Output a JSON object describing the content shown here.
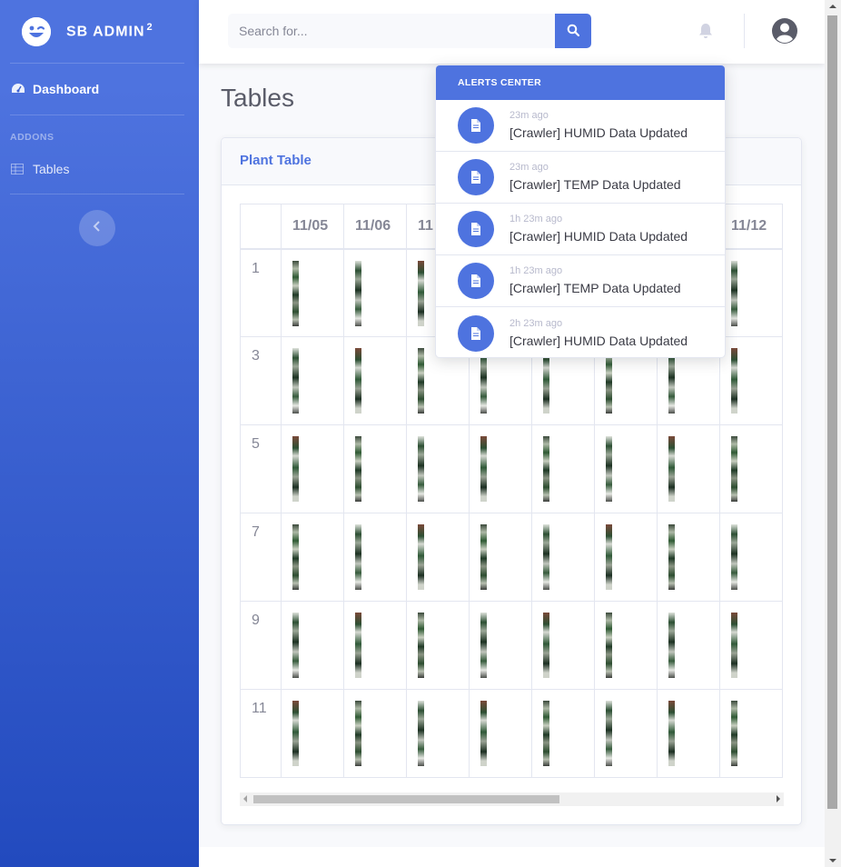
{
  "sidebar": {
    "brand": "SB ADMIN",
    "brand_sup": "2",
    "dashboard_label": "Dashboard",
    "addons_heading": "ADDONS",
    "tables_label": "Tables"
  },
  "topbar": {
    "search_placeholder": "Search for..."
  },
  "page": {
    "title": "Tables"
  },
  "card": {
    "title": "Plant Table"
  },
  "table": {
    "headers": [
      "",
      "11/05",
      "11/06",
      "11",
      "",
      "",
      "",
      "",
      "11/12"
    ],
    "row_labels": [
      "1",
      "3",
      "5",
      "7",
      "9",
      "11"
    ]
  },
  "alerts": {
    "header": "ALERTS CENTER",
    "items": [
      {
        "time": "23m ago",
        "text": "[Crawler] HUMID Data Updated"
      },
      {
        "time": "23m ago",
        "text": "[Crawler] TEMP Data Updated"
      },
      {
        "time": "1h 23m ago",
        "text": "[Crawler] HUMID Data Updated"
      },
      {
        "time": "1h 23m ago",
        "text": "[Crawler] TEMP Data Updated"
      },
      {
        "time": "2h 23m ago",
        "text": "[Crawler] HUMID Data Updated"
      }
    ]
  },
  "colors": {
    "primary": "#4e73df",
    "sidebar_gradient_end": "#224abe"
  },
  "icons": {
    "brand": "laugh-wink-icon",
    "dashboard": "tachometer-icon",
    "tables": "table-icon",
    "toggle": "chevron-left-icon",
    "search": "search-icon",
    "bell": "bell-icon",
    "user": "user-circle-icon",
    "alert": "file-icon"
  }
}
